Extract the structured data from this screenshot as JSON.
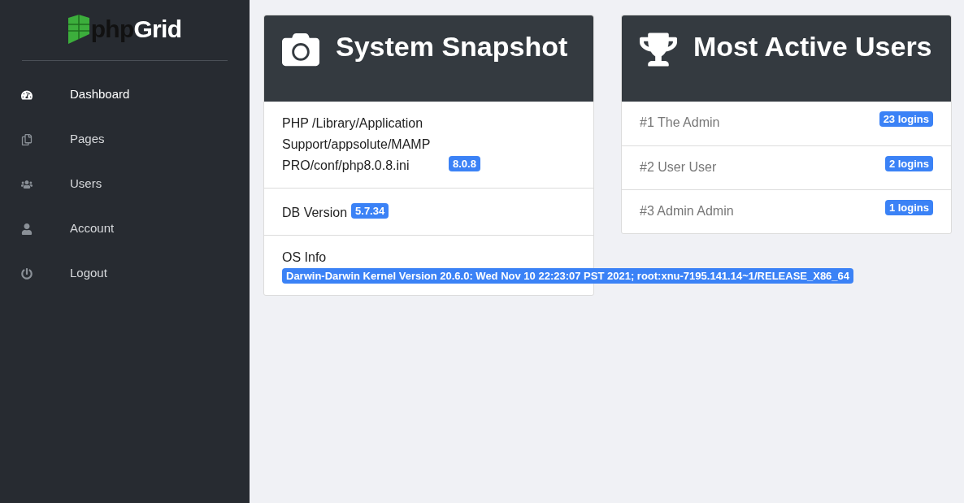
{
  "logo": {
    "part_1": "php",
    "part_2": "Grid"
  },
  "sidebar": {
    "items": [
      {
        "label": "Dashboard",
        "kind": "dashboard",
        "selected": true
      },
      {
        "label": "Pages",
        "kind": "pages",
        "selected": false
      },
      {
        "label": "Users",
        "kind": "users",
        "selected": false
      },
      {
        "label": "Account",
        "kind": "account",
        "selected": false
      },
      {
        "label": "Logout",
        "kind": "logout",
        "selected": false
      }
    ]
  },
  "system_snapshot": {
    "title": "System Snapshot",
    "rows": [
      {
        "label": "PHP /Library/Application Support/appsolute/MAMP PRO/conf/php8.0.8.ini",
        "badge": "8.0.8",
        "kind": "inline"
      },
      {
        "label": "DB Version",
        "badge": "5.7.34",
        "kind": "inline"
      },
      {
        "label": "OS Info",
        "badge": "Darwin-Darwin Kernel Version 20.6.0: Wed Nov 10 22:23:07 PST 2021; root:xnu-7195.141.14~1/RELEASE_X86_64",
        "kind": "block"
      }
    ]
  },
  "most_active_users": {
    "title": "Most Active Users",
    "rows": [
      {
        "name": "#1 The Admin",
        "badge": "23 logins"
      },
      {
        "name": "#2 User User",
        "badge": "2 logins"
      },
      {
        "name": "#3 Admin Admin",
        "badge": "1 logins"
      }
    ]
  }
}
